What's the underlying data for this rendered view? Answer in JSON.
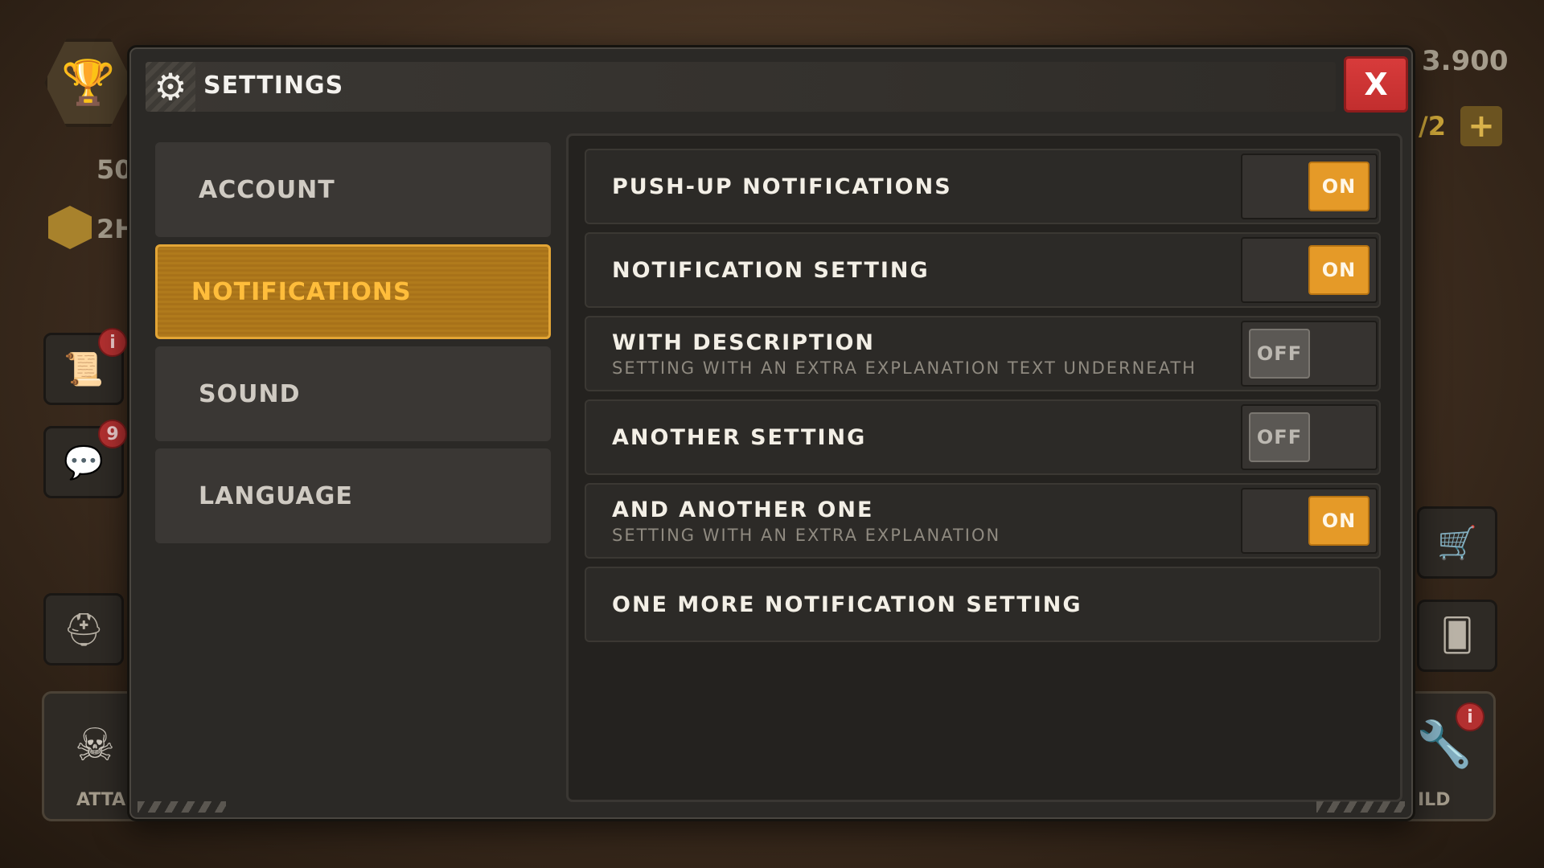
{
  "background": {
    "hud_values": {
      "gold": "3.900",
      "counter": "/2",
      "resource_1": "50",
      "resource_2": "2H",
      "attack_label": "ATTA",
      "build_label": "ILD"
    },
    "badges": {
      "quests": "i",
      "chat": "9",
      "build": "i"
    }
  },
  "modal": {
    "title": "SETTINGS",
    "close_label": "X",
    "tabs": [
      {
        "label": "ACCOUNT",
        "active": false
      },
      {
        "label": "NOTIFICATIONS",
        "active": true
      },
      {
        "label": "SOUND",
        "active": false
      },
      {
        "label": "LANGUAGE",
        "active": false
      }
    ],
    "settings": [
      {
        "label": "PUSH-UP NOTIFICATIONS",
        "description": "",
        "state": "ON"
      },
      {
        "label": "NOTIFICATION SETTING",
        "description": "",
        "state": "ON"
      },
      {
        "label": "WITH DESCRIPTION",
        "description": "SETTING WITH AN EXTRA EXPLANATION TEXT UNDERNEATH",
        "state": "OFF"
      },
      {
        "label": "ANOTHER SETTING",
        "description": "",
        "state": "OFF"
      },
      {
        "label": "AND ANOTHER ONE",
        "description": "SETTING WITH AN EXTRA EXPLANATION",
        "state": "ON"
      },
      {
        "label": "ONE MORE NOTIFICATION SETTING",
        "description": "",
        "state": ""
      }
    ]
  },
  "colors": {
    "accent": "#e59a28",
    "close": "#d83b3b",
    "active_tab_text": "#ffbd3b"
  },
  "icons": {
    "settings": "gear-icon",
    "trophy": "trophy-icon",
    "cart": "cart-icon",
    "chat": "chat-icon"
  }
}
